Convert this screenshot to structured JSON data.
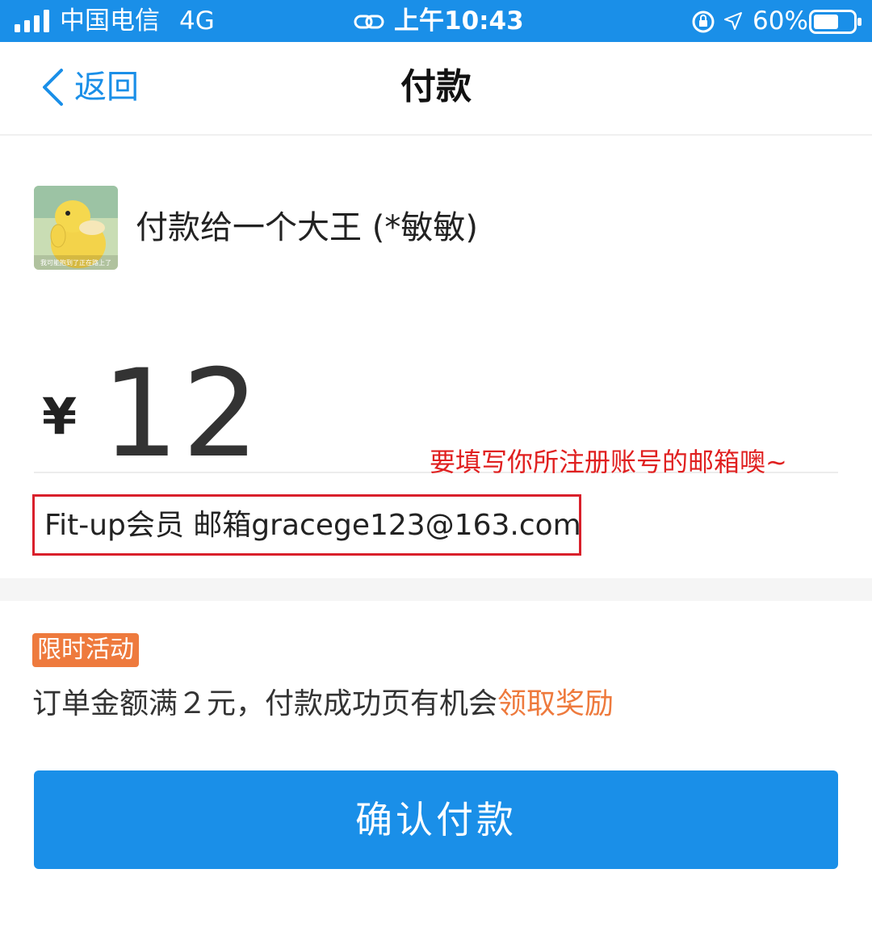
{
  "status_bar": {
    "carrier": "中国电信",
    "network": "4G",
    "time": "上午10:43",
    "battery": "60%"
  },
  "nav": {
    "back_label": "返回",
    "title": "付款"
  },
  "payee": {
    "text": "付款给一个大王 (*敏敏)",
    "avatar_caption": "我可能抱到了正在路上了"
  },
  "amount": {
    "currency": "¥",
    "value": "12"
  },
  "annotation": "要填写你所注册账号的邮箱噢~",
  "note": "Fit-up会员 邮箱gracege123@163.com",
  "promo": {
    "tag": "限时活动",
    "text": "订单金额满２元，付款成功页有机会",
    "link": "领取奖励"
  },
  "confirm_button": "确认付款",
  "colors": {
    "brand": "#1a8fe8",
    "promo": "#ee7a3d",
    "annotation": "#e02020"
  }
}
